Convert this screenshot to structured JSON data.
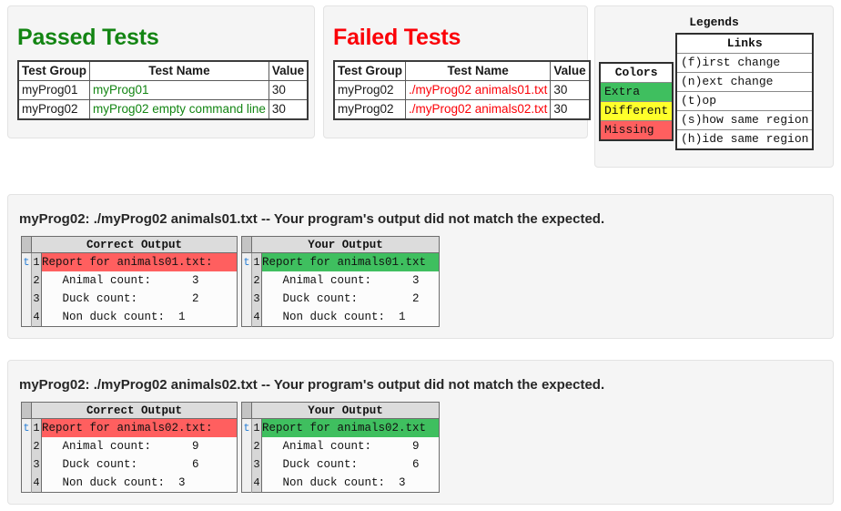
{
  "passed": {
    "title": "Passed Tests",
    "columns": [
      "Test Group",
      "Test Name",
      "Value"
    ],
    "rows": [
      {
        "group": "myProg01",
        "name": "myProg01",
        "value": "30"
      },
      {
        "group": "myProg02",
        "name": "myProg02 empty command line",
        "value": "30"
      }
    ]
  },
  "failed": {
    "title": "Failed Tests",
    "columns": [
      "Test Group",
      "Test Name",
      "Value"
    ],
    "rows": [
      {
        "group": "myProg02",
        "name": "./myProg02 animals01.txt",
        "value": "30"
      },
      {
        "group": "myProg02",
        "name": "./myProg02 animals02.txt",
        "value": "30"
      }
    ]
  },
  "legends": {
    "title": "Legends",
    "colors": {
      "header": "Colors",
      "items": [
        {
          "label": "Extra",
          "color": "#3fbf5f"
        },
        {
          "label": "Different",
          "color": "#ffff2b"
        },
        {
          "label": "Missing",
          "color": "#ff5f5f"
        }
      ]
    },
    "links": {
      "header": "Links",
      "items": [
        "(f)irst change",
        "(n)ext change",
        "(t)op",
        "(s)how same region",
        "(h)ide same region"
      ]
    }
  },
  "diffs": [
    {
      "title": "myProg02: ./myProg02 animals01.txt -- Your program's output did not match the expected.",
      "correct": {
        "header": "Correct Output",
        "lines": [
          {
            "link": "t",
            "num": "1",
            "text": "Report for animals01.txt:",
            "highlight": "missing"
          },
          {
            "link": "",
            "num": "2",
            "text": "   Animal count:      3",
            "highlight": "none"
          },
          {
            "link": "",
            "num": "3",
            "text": "   Duck count:        2",
            "highlight": "none"
          },
          {
            "link": "",
            "num": "4",
            "text": "   Non duck count:  1",
            "highlight": "none"
          }
        ]
      },
      "yours": {
        "header": "Your Output",
        "lines": [
          {
            "link": "t",
            "num": "1",
            "text": "Report for animals01.txt",
            "highlight": "extra"
          },
          {
            "link": "",
            "num": "2",
            "text": "   Animal count:      3",
            "highlight": "none"
          },
          {
            "link": "",
            "num": "3",
            "text": "   Duck count:        2",
            "highlight": "none"
          },
          {
            "link": "",
            "num": "4",
            "text": "   Non duck count:  1",
            "highlight": "none"
          }
        ]
      }
    },
    {
      "title": "myProg02: ./myProg02 animals02.txt -- Your program's output did not match the expected.",
      "correct": {
        "header": "Correct Output",
        "lines": [
          {
            "link": "t",
            "num": "1",
            "text": "Report for animals02.txt:",
            "highlight": "missing"
          },
          {
            "link": "",
            "num": "2",
            "text": "   Animal count:      9",
            "highlight": "none"
          },
          {
            "link": "",
            "num": "3",
            "text": "   Duck count:        6",
            "highlight": "none"
          },
          {
            "link": "",
            "num": "4",
            "text": "   Non duck count:  3",
            "highlight": "none"
          }
        ]
      },
      "yours": {
        "header": "Your Output",
        "lines": [
          {
            "link": "t",
            "num": "1",
            "text": "Report for animals02.txt",
            "highlight": "extra"
          },
          {
            "link": "",
            "num": "2",
            "text": "   Animal count:      9",
            "highlight": "none"
          },
          {
            "link": "",
            "num": "3",
            "text": "   Duck count:        6",
            "highlight": "none"
          },
          {
            "link": "",
            "num": "4",
            "text": "   Non duck count:  3",
            "highlight": "none"
          }
        ]
      }
    }
  ]
}
